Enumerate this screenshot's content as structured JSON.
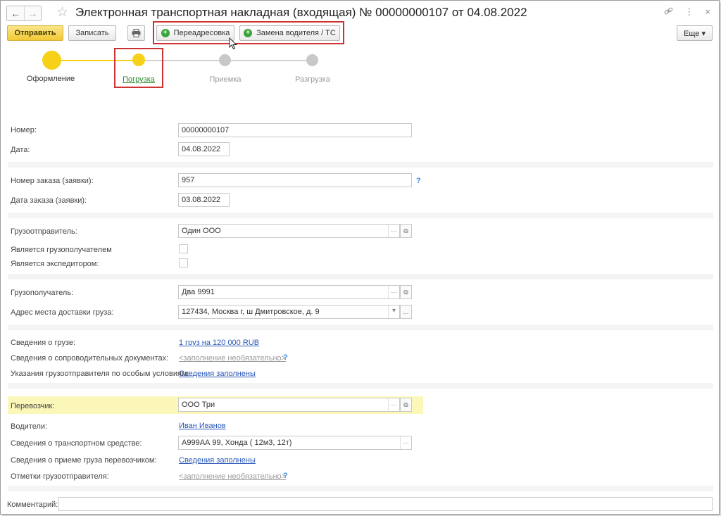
{
  "window": {
    "title": "Электронная транспортная накладная (входящая) № 00000000107 от 04.08.2022",
    "nav": {
      "back": "←",
      "forward": "→"
    },
    "star": "☆",
    "icons": {
      "link": "🔗",
      "more": "⋮",
      "close": "×"
    }
  },
  "toolbar": {
    "send": "Отправить",
    "save": "Записать",
    "print": "🖶",
    "readdress": "Переадресовка",
    "replace_driver": "Замена водителя / ТС",
    "more": "Еще ▾"
  },
  "steps": [
    {
      "label": "Оформление",
      "state": "done"
    },
    {
      "label": "Погрузка",
      "state": "current"
    },
    {
      "label": "Приемка",
      "state": "pending"
    },
    {
      "label": "Разгрузка",
      "state": "pending"
    }
  ],
  "form": {
    "number_label": "Номер:",
    "number_value": "00000000107",
    "date_label": "Дата:",
    "date_value": "04.08.2022",
    "order_number_label": "Номер заказа (заявки):",
    "order_number_value": "957",
    "order_date_label": "Дата заказа (заявки):",
    "order_date_value": "03.08.2022",
    "shipper_label": "Грузоотправитель:",
    "shipper_value": "Один ООО",
    "is_consignee_label": "Является грузополучателем",
    "is_forwarder_label": "Является экспедитором:",
    "consignee_label": "Грузополучатель:",
    "consignee_value": "Два 9991",
    "delivery_address_label": "Адрес места доставки груза:",
    "delivery_address_value": "127434, Москва г, ш Дмитровское, д. 9",
    "cargo_info_label": "Сведения о грузе:",
    "cargo_info_value": "1 груз на 120 000 RUB",
    "docs_label": "Сведения о сопроводительных документах:",
    "docs_value": "<заполнение необязательно>",
    "special_label": "Указания грузоотправителя по особым условиям:",
    "special_value": "Сведения заполнены",
    "carrier_label": "Перевозчик:",
    "carrier_value": "ООО Три",
    "drivers_label": "Водители:",
    "drivers_value": "Иван Иванов",
    "vehicle_label": "Сведения о транспортном средстве:",
    "vehicle_value": "А999АА 99, Хонда ( 12м3, 12т)",
    "acceptance_label": "Сведения о приеме груза перевозчиком:",
    "acceptance_value": "Сведения заполнены",
    "shipper_marks_label": "Отметки грузоотправителя:",
    "shipper_marks_value": "<заполнение необязательно>",
    "comment_label": "Комментарий:",
    "comment_value": "",
    "help": "?",
    "dots": "...",
    "open": "⧉",
    "dropdown": "▾"
  },
  "colors": {
    "accent_yellow": "#f7d117",
    "pending_gray": "#c8c8c8",
    "link_blue": "#2858b8",
    "current_link_green": "#2a8a2a",
    "highlight": "#fbf7b9",
    "red_frame": "#cc3333"
  }
}
